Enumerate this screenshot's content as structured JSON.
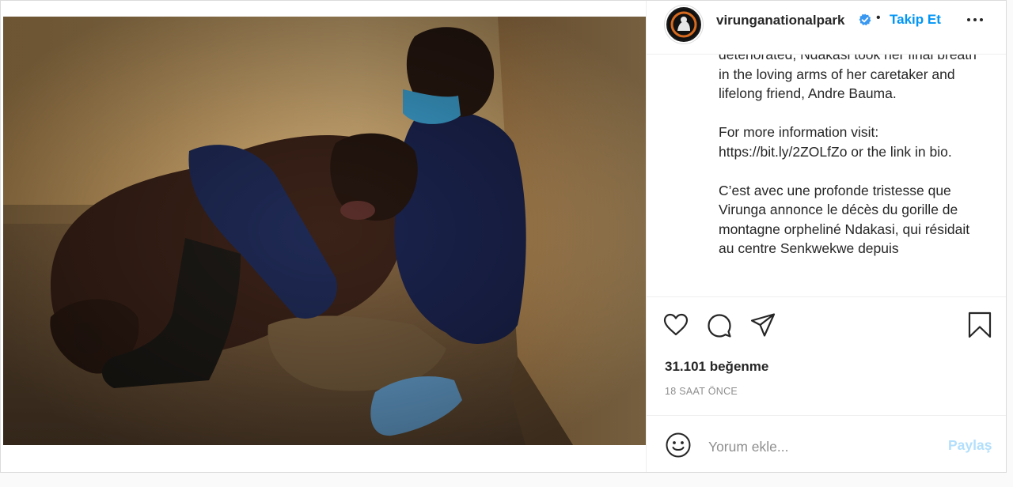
{
  "account": {
    "username": "virunganationalpark",
    "separator": "•",
    "follow_label": "Takip Et"
  },
  "caption": {
    "paragraphs": [
      "deteriorated, Ndakasi took her final breath in the loving arms of her caretaker and lifelong friend, Andre Bauma.",
      "For more information visit: https://bit.ly/2ZOLfZo or the link in bio.",
      "C’est avec une profonde tristesse que Virunga annonce le décès du gorille de montagne orpheliné Ndakasi, qui résidait au centre Senkwekwe depuis"
    ]
  },
  "actions": {
    "icons": [
      "heart-icon",
      "comment-icon",
      "share-icon",
      "bookmark-icon"
    ]
  },
  "likes_text": "31.101 beğenme",
  "time_ago": "18 SAAT ÖNCE",
  "comment": {
    "placeholder": "Yorum ekle...",
    "post_label": "Paylaş"
  },
  "colors": {
    "link_blue": "#0095f6",
    "disabled_blue": "#b2dffc",
    "text": "#262626",
    "muted": "#8e8e8e",
    "border": "#dbdbdb"
  }
}
